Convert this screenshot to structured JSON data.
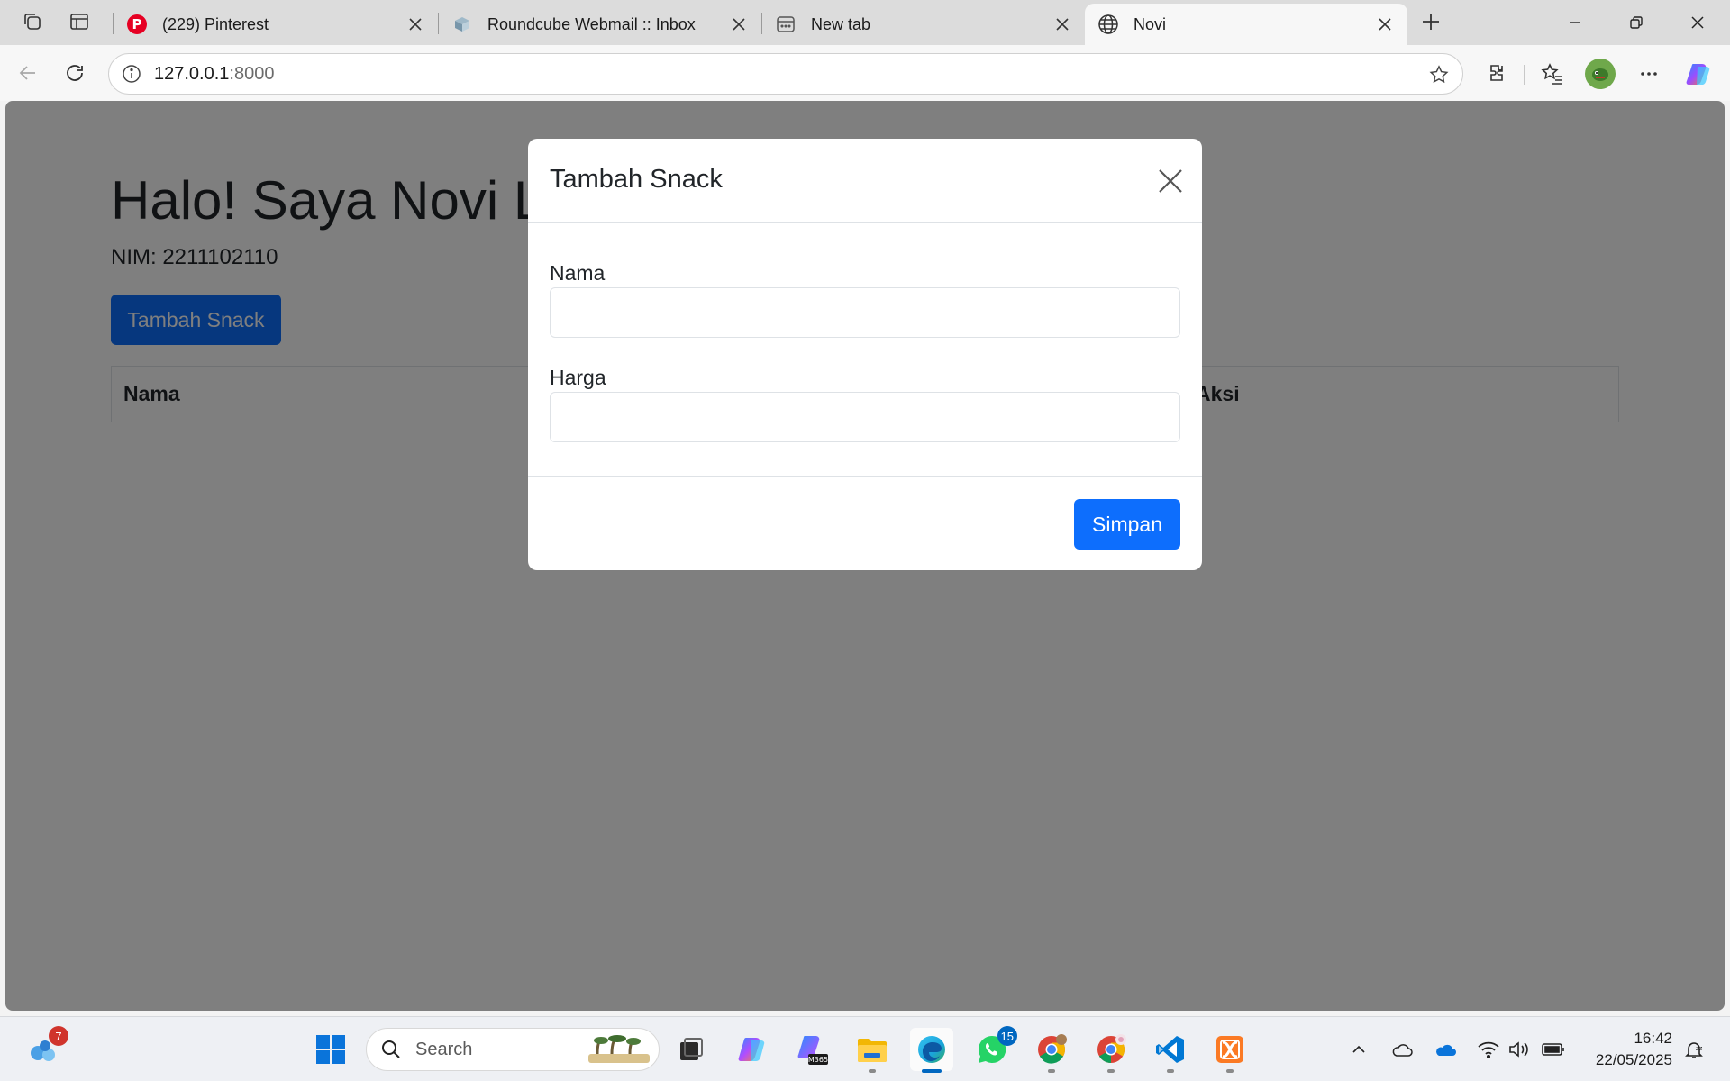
{
  "browser": {
    "tabs": [
      {
        "title": "(229) Pinterest",
        "favicon": "pinterest-icon"
      },
      {
        "title": "Roundcube Webmail :: Inbox",
        "favicon": "roundcube-icon"
      },
      {
        "title": "New tab",
        "favicon": "new-tab-icon"
      },
      {
        "title": "Novi",
        "favicon": "globe-icon",
        "active": true
      }
    ],
    "address": {
      "host": "127.0.0.1",
      "port": ":8000"
    }
  },
  "page": {
    "heading": "Halo! Saya Novi L",
    "nim": "NIM: 2211102110",
    "add_button": "Tambah Snack",
    "table_headers": [
      "Nama",
      "Aksi"
    ]
  },
  "modal": {
    "title": "Tambah Snack",
    "fields": [
      {
        "label": "Nama",
        "value": ""
      },
      {
        "label": "Harga",
        "value": ""
      }
    ],
    "save_button": "Simpan"
  },
  "taskbar": {
    "search_placeholder": "Search",
    "badges": {
      "widgets": "7",
      "whatsapp": "15"
    },
    "clock": {
      "time": "16:42",
      "date": "22/05/2025"
    }
  },
  "colors": {
    "primary": "#0d6efd",
    "backdrop": "rgba(0,0,0,0.5)"
  }
}
